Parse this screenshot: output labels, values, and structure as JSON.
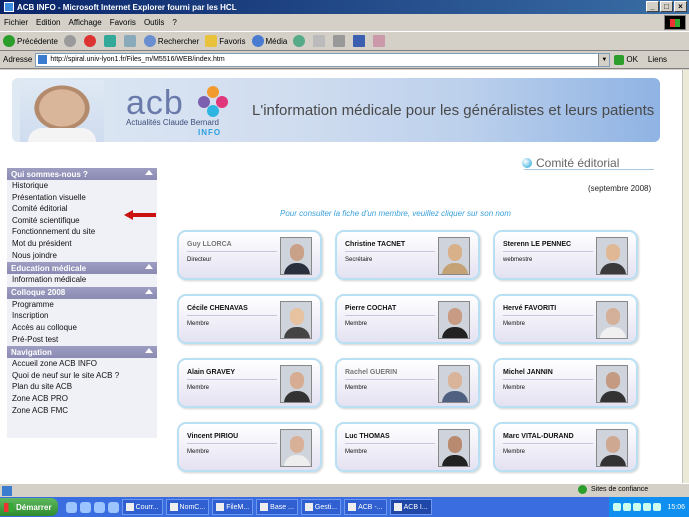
{
  "window": {
    "title": "ACB INFO - Microsoft Internet Explorer fourni par les HCL"
  },
  "menu": [
    "Fichier",
    "Edition",
    "Affichage",
    "Favoris",
    "Outils",
    "?"
  ],
  "toolbar": {
    "back": "Précédente",
    "search": "Rechercher",
    "favorites": "Favoris",
    "media": "Média"
  },
  "address": {
    "label": "Adresse",
    "url": "http://spiral.univ-lyon1.fr/Files_m/M5516/WEB/index.htm",
    "go": "OK",
    "links": "Liens"
  },
  "banner": {
    "logo_text": "acb",
    "logo_subtitle": "Actualités Claude Bernard",
    "logo_info": "INFO",
    "slogan": "L'information médicale pour les généralistes et leurs patients"
  },
  "sidebar": {
    "sections": [
      {
        "title": "Qui sommes-nous ?",
        "items": [
          "Historique",
          "Présentation visuelle",
          "Comité éditorial",
          "Comité scientifique",
          "Fonctionnement du site",
          "Mot du président",
          "Nous joindre"
        ]
      },
      {
        "title": "Education médicale",
        "items": [
          "Information médicale"
        ]
      },
      {
        "title": "Colloque 2008",
        "items": [
          "Programme",
          "Inscription",
          "Accès au colloque",
          "Pré-Post test"
        ]
      },
      {
        "title": "Navigation",
        "items": [
          "Accueil zone ACB INFO",
          "Quoi de neuf sur le site ACB ?",
          "Plan du site ACB",
          "Zone ACB PRO",
          "Zone ACB FMC"
        ]
      }
    ]
  },
  "main": {
    "heading": "Comité éditorial",
    "date": "(septembre 2008)",
    "instructions": "Pour consulter la fiche d'un membre, veuillez cliquer sur son nom",
    "members": [
      {
        "name": "Guy LLORCA",
        "role": "Directeur",
        "muted": true
      },
      {
        "name": "Christine TACNET",
        "role": "Secrétaire",
        "muted": false
      },
      {
        "name": "Sterenn LE PENNEC",
        "role": "webmestre",
        "muted": false
      },
      {
        "name": "Cécile CHENAVAS",
        "role": "Membre",
        "muted": false
      },
      {
        "name": "Pierre COCHAT",
        "role": "Membre",
        "muted": false
      },
      {
        "name": "Hervé FAVORITI",
        "role": "Membre",
        "muted": false
      },
      {
        "name": "Alain GRAVEY",
        "role": "Membre",
        "muted": false
      },
      {
        "name": "Rachel GUERIN",
        "role": "Membre",
        "muted": true
      },
      {
        "name": "Michel JANNIN",
        "role": "Membre",
        "muted": false
      },
      {
        "name": "Vincent PIRIOU",
        "role": "Membre",
        "muted": false
      },
      {
        "name": "Luc THOMAS",
        "role": "Membre",
        "muted": false
      },
      {
        "name": "Marc VITAL-DURAND",
        "role": "Membre",
        "muted": false
      }
    ]
  },
  "status": {
    "zone": "Sites de confiance"
  },
  "taskbar": {
    "start": "Démarrer",
    "tasks": [
      "Courr...",
      "NomC...",
      "FileM...",
      "Base ...",
      "Gesti...",
      "ACB -...",
      "ACB I..."
    ],
    "clock": "15:06"
  },
  "colors": {
    "accent": "#8a8ab3",
    "link": "#3aa0d9",
    "arrow": "#cc1111"
  }
}
